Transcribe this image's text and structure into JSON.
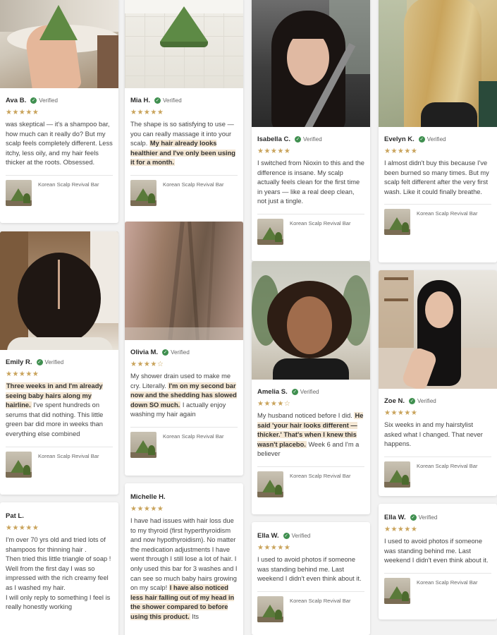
{
  "product_name": "Korean Scalp Revival Bar",
  "verified_label": "Verified",
  "reviews": [
    {
      "name": "Ava B.",
      "stars": "★★★★★",
      "empty": "",
      "body": [
        [
          "was skeptical — it's a shampoo bar, how much can it really do? But my scalp feels completely different. Less itchy, less oily, and my hair feels thicker at the roots. Obsessed.",
          false
        ]
      ]
    },
    {
      "name": "Mia H.",
      "stars": "★★★★★",
      "empty": "",
      "body": [
        [
          "The shape is so satisfying to use — you can really massage it into your scalp. ",
          false
        ],
        [
          "My hair already looks healthier and I've only been using it for a month.",
          true
        ]
      ]
    },
    {
      "name": "Isabella C.",
      "stars": "★★★★★",
      "empty": "",
      "body": [
        [
          "I switched from Nioxin to this and the difference is insane. My scalp actually feels clean for the first time in years — like a real deep clean, not just a tingle.",
          false
        ]
      ]
    },
    {
      "name": "Evelyn K.",
      "stars": "★★★★★",
      "empty": "",
      "body": [
        [
          "I almost didn't buy this because I've been burned so many times. But my scalp felt different after the very first wash. Like it could finally breathe.",
          false
        ]
      ]
    },
    {
      "name": "Emily R.",
      "stars": "★★★★★",
      "empty": "",
      "body": [
        [
          "Three weeks in and I'm already seeing baby hairs along my hairline.",
          true
        ],
        [
          " I've spent hundreds on serums that did nothing. This little green bar did more in weeks than everything else combined",
          false
        ]
      ]
    },
    {
      "name": "Olivia M.",
      "stars": "★★★★",
      "empty": "☆",
      "body": [
        [
          "My shower drain used to make me cry. Literally. ",
          false
        ],
        [
          "I'm on my second bar now and the shedding has slowed down SO much.",
          true
        ],
        [
          " I actually enjoy washing my hair again",
          false
        ]
      ]
    },
    {
      "name": "Amelia S.",
      "stars": "★★★★",
      "empty": "☆",
      "body": [
        [
          "My husband noticed before I did. ",
          false
        ],
        [
          "He said 'your hair looks different — thicker.' That's when I knew this wasn't placebo.",
          true
        ],
        [
          " Week 6 and I'm a believer",
          false
        ]
      ]
    },
    {
      "name": "Zoe N.",
      "stars": "★★★★★",
      "empty": "",
      "body": [
        [
          "Six weeks in and my hairstylist asked what I changed. That never happens.",
          false
        ]
      ]
    },
    {
      "name": "Pat L.",
      "stars": "★★★★★",
      "empty": "",
      "body": [
        [
          "I'm over 70 yrs old and tried lots of shampoos for thinning hair .",
          false
        ],
        [
          "\nThen tried this little triangle of soap !",
          false
        ],
        [
          "\nWell from the first day I was so impressed with the rich creamy feel as I washed my hair.",
          false
        ],
        [
          "\nI will only reply to something I feel is really honestly working",
          false
        ]
      ]
    },
    {
      "name": "Michelle H.",
      "stars": "★★★★★",
      "empty": "",
      "body": [
        [
          "I have had issues with hair loss due to my thyroid (first hyperthyroidism and now hypothyroidism). No matter the medication adjustments I have went through I still lose a lot of hair. I only used this bar for 3 washes and I can see so much baby hairs growing on my scalp! ",
          false
        ],
        [
          "I have also noticed less hair falling out of my head in the shower compared to before using this product.",
          true
        ],
        [
          " Its",
          false
        ]
      ]
    },
    {
      "name": "Ella W.",
      "stars": "★★★★★",
      "empty": "",
      "body": [
        [
          "I used to avoid photos if someone was standing behind me. Last weekend I didn't even think about it.",
          false
        ]
      ]
    },
    {
      "name": "Ella W.",
      "stars": "★★★★★",
      "empty": "",
      "body": [
        [
          "I used to avoid photos if someone was standing behind me. Last weekend I didn't even think about it.",
          false
        ]
      ]
    }
  ]
}
